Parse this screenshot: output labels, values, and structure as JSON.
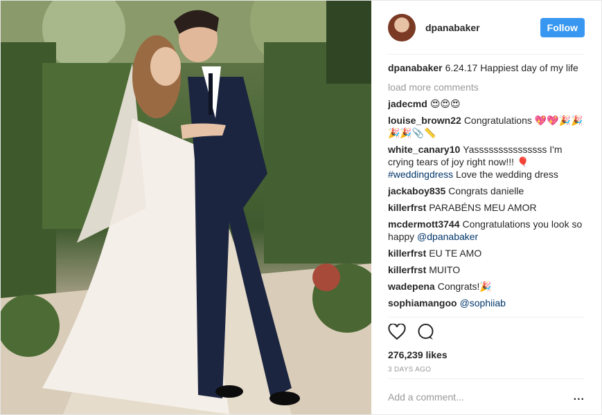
{
  "post": {
    "author": "dpanabaker",
    "follow_label": "Follow",
    "caption": {
      "user": "dpanabaker",
      "text": "6.24.17 Happiest day of my life"
    },
    "load_more_label": "load more comments",
    "comments": [
      {
        "user": "jadecmd",
        "text": "😍😍😍",
        "link": "",
        "tail": ""
      },
      {
        "user": "louise_brown22",
        "text": "Congratulations 💖💖🎉🎉 🎉🎉📎📏",
        "link": "",
        "tail": ""
      },
      {
        "user": "white_canary10",
        "text": "Yasssssssssssssss I'm crying tears of joy right now!!! 🎈",
        "link": "#weddingdress",
        "tail": " Love the wedding dress"
      },
      {
        "user": "jackaboy835",
        "text": "Congrats danielle",
        "link": "",
        "tail": ""
      },
      {
        "user": "killerfrst",
        "text": "PARABÉNS MEU AMOR",
        "link": "",
        "tail": ""
      },
      {
        "user": "mcdermott3744",
        "text": "Congratulations you look so happy",
        "link": "@dpanabaker",
        "tail": ""
      },
      {
        "user": "killerfrst",
        "text": "EU TE AMO",
        "link": "",
        "tail": ""
      },
      {
        "user": "killerfrst",
        "text": "MUITO",
        "link": "",
        "tail": ""
      },
      {
        "user": "wadepena",
        "text": "Congrats!🎉",
        "link": "",
        "tail": ""
      },
      {
        "user": "sophiamangoo",
        "text": "",
        "link": "@sophiiab",
        "tail": ""
      }
    ],
    "likes": "276,239 likes",
    "time": "3 DAYS AGO",
    "comment_placeholder": "Add a comment...",
    "more_label": "..."
  },
  "icons": {
    "like": "heart-icon",
    "comment": "comment-bubble-icon",
    "more": "more-options-icon"
  },
  "colors": {
    "follow_button": "#3897f0",
    "link": "#003569",
    "muted": "#999999"
  }
}
